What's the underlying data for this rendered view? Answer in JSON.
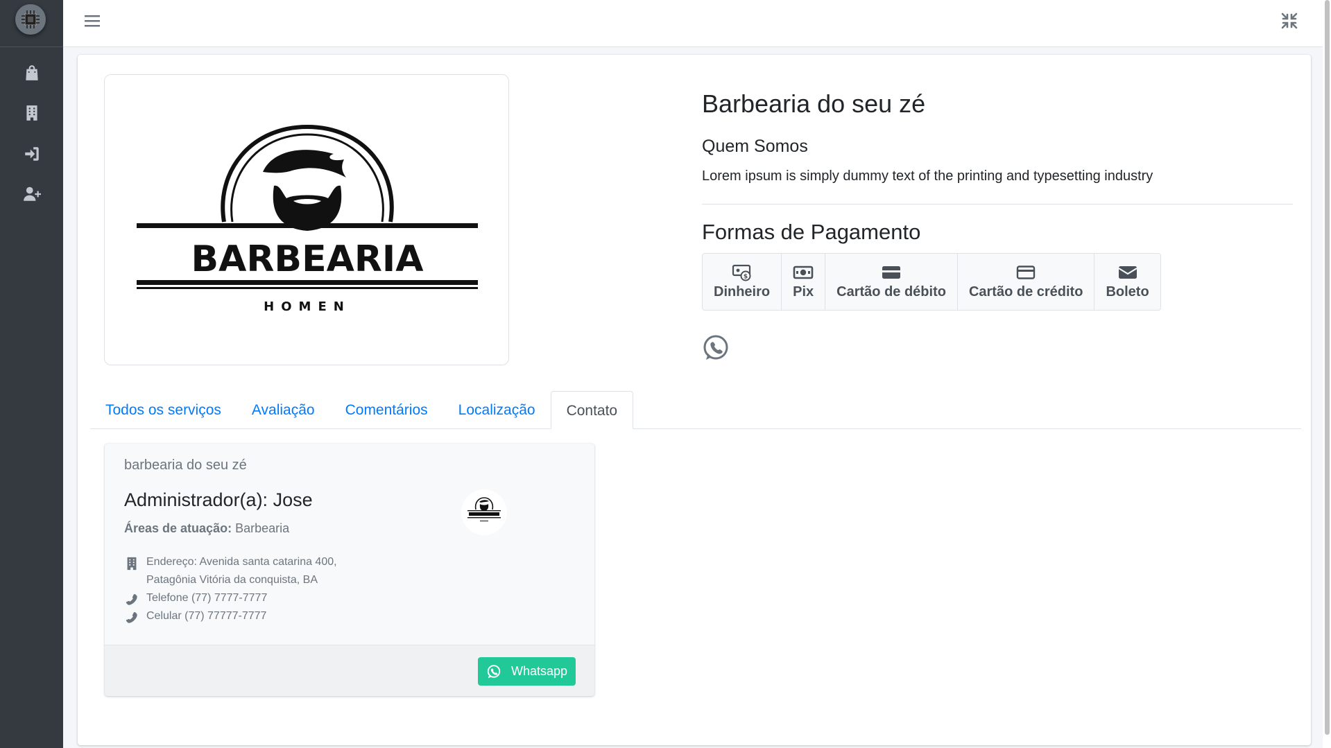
{
  "sidebar": {
    "brand_icon": "cpu-logo-icon",
    "items": [
      {
        "name": "shopping-bag-icon"
      },
      {
        "name": "building-icon"
      },
      {
        "name": "sign-in-icon"
      },
      {
        "name": "user-plus-icon"
      }
    ]
  },
  "topbar": {
    "menu_icon": "hamburger-menu-icon",
    "compress_icon": "compress-icon"
  },
  "logo": {
    "title": "BARBEARIA",
    "subtitle": "HOMEN"
  },
  "shop": {
    "name": "Barbearia do seu zé",
    "about_title": "Quem Somos",
    "about_text": "Lorem ipsum is simply dummy text of the printing and typesetting industry",
    "payment_title": "Formas de Pagamento",
    "payments": [
      {
        "label": "Dinheiro",
        "icon": "money-icon"
      },
      {
        "label": "Pix",
        "icon": "pix-icon"
      },
      {
        "label": "Cartão de débito",
        "icon": "debit-card-icon"
      },
      {
        "label": "Cartão de crédito",
        "icon": "credit-card-icon"
      },
      {
        "label": "Boleto",
        "icon": "boleto-icon"
      }
    ]
  },
  "tabs": [
    {
      "label": "Todos os serviços",
      "active": false
    },
    {
      "label": "Avaliação",
      "active": false
    },
    {
      "label": "Comentários",
      "active": false
    },
    {
      "label": "Localização",
      "active": false
    },
    {
      "label": "Contato",
      "active": true
    }
  ],
  "contact": {
    "header": "barbearia do seu zé",
    "admin": "Administrador(a): Jose",
    "areas_label": "Áreas de atuação:",
    "areas_value": "Barbearia",
    "address_line1": "Endereço: Avenida santa catarina 400,",
    "address_line2": "Patagônia Vitória da conquista, BA",
    "phone": "Telefone (77) 7777-7777",
    "mobile": "Celular (77) 77777-7777",
    "whatsapp_label": "Whatsapp"
  },
  "colors": {
    "sidebar": "#343a40",
    "link": "#007bff",
    "whatsapp": "#20c997"
  }
}
